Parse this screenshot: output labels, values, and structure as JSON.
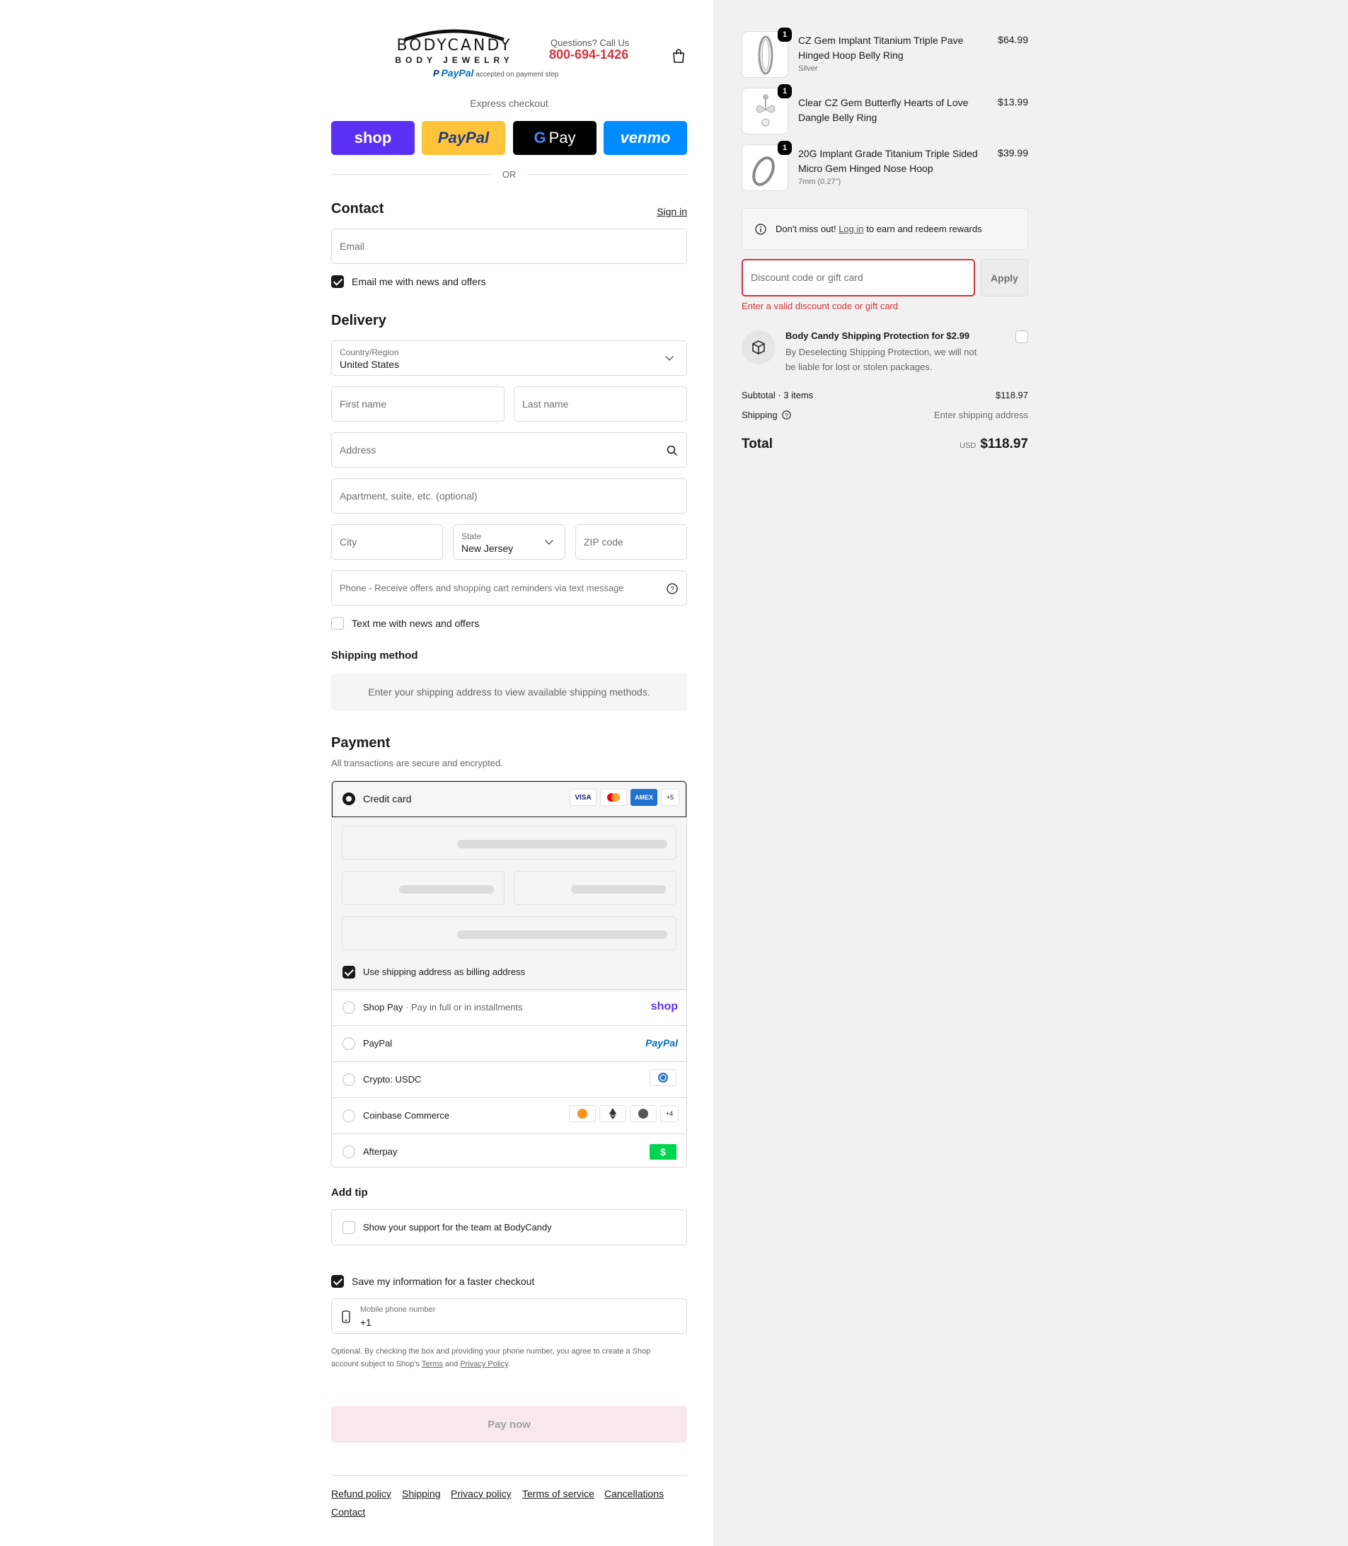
{
  "header": {
    "brand_name": "BODYCANDY",
    "brand_sub": "BODY JEWELRY",
    "questions_label": "Questions? Call Us",
    "phone": "800-694-1426",
    "paypal_label": "PayPal",
    "paypal_note": "accepted on payment step"
  },
  "express": {
    "title": "Express checkout",
    "shop": "shop",
    "paypal": "PayPal",
    "gpay": "Pay",
    "venmo": "venmo",
    "or": "OR"
  },
  "contact": {
    "title": "Contact",
    "sign_in": "Sign in",
    "email_placeholder": "Email",
    "newsletter_label": "Email me with news and offers"
  },
  "delivery": {
    "title": "Delivery",
    "country_label": "Country/Region",
    "country_value": "United States",
    "first_name": "First name",
    "last_name": "Last name",
    "address": "Address",
    "apartment": "Apartment, suite, etc. (optional)",
    "city": "City",
    "state_label": "State",
    "state_value": "New Jersey",
    "zip": "ZIP code",
    "phone": "Phone - Receive offers and shopping cart reminders via text message",
    "sms_label": "Text me with news and offers"
  },
  "shipping_method": {
    "title": "Shipping method",
    "notice": "Enter your shipping address to view available shipping methods."
  },
  "payment": {
    "title": "Payment",
    "subtitle": "All transactions are secure and encrypted.",
    "credit_card": "Credit card",
    "cards": [
      "VISA",
      "AMEX",
      "+5"
    ],
    "billing_label": "Use shipping address as billing address",
    "shop_pay": "Shop Pay",
    "shop_pay_note": "Pay in full or in installments",
    "shop_logo": "shop",
    "paypal": "PayPal",
    "paypal_logo": "PayPal",
    "crypto": "Crypto: USDC",
    "coinbase": "Coinbase Commerce",
    "coinbase_more": "+4",
    "afterpay": "Afterpay",
    "afterpay_logo": "$"
  },
  "tip": {
    "title": "Add tip",
    "label": "Show your support for the team at BodyCandy"
  },
  "save_info": {
    "label": "Save my information for a faster checkout",
    "mobile_label": "Mobile phone number",
    "mobile_value": "+1",
    "legal_1": "Optional. By checking the box and providing your phone number, you agree to create a Shop",
    "legal_2": "account subject to Shop's",
    "terms": "Terms",
    "and": "and",
    "privacy": "Privacy Policy",
    "period": "."
  },
  "pay_now": "Pay now",
  "footer": [
    "Refund policy",
    "Shipping",
    "Privacy policy",
    "Terms of service",
    "Cancellations",
    "Contact"
  ],
  "order": {
    "items": [
      {
        "name_1": "CZ Gem Implant Titanium Triple Pave",
        "name_2": "Hinged Hoop Belly Ring",
        "variant": "Silver",
        "price": "$64.99",
        "qty": "1"
      },
      {
        "name_1": "Clear CZ Gem Butterfly Hearts of Love",
        "name_2": "Dangle Belly Ring",
        "variant": "",
        "price": "$13.99",
        "qty": "1"
      },
      {
        "name_1": "20G Implant Grade Titanium Triple Sided",
        "name_2": "Micro Gem Hinged Nose Hoop",
        "variant": "7mm (0.27\")",
        "price": "$39.99",
        "qty": "1"
      }
    ],
    "rewards_pre": "Don't miss out!",
    "rewards_link": "Log in",
    "rewards_post": "to earn and redeem rewards",
    "discount_placeholder": "Discount code or gift card",
    "apply": "Apply",
    "discount_error": "Enter a valid discount code or gift card",
    "protection_title": "Body Candy Shipping Protection for $2.99",
    "protection_desc_1": "By Deselecting Shipping Protection, we will not",
    "protection_desc_2": "be liable for lost or stolen packages.",
    "subtotal_label": "Subtotal · 3 items",
    "subtotal_value": "$118.97",
    "shipping_label": "Shipping",
    "shipping_value": "Enter shipping address",
    "total_label": "Total",
    "currency": "USD",
    "total_value": "$118.97"
  },
  "colors": {
    "accent": "#d2333f",
    "shop_purple": "#5a31f4",
    "paypal_yellow": "#ffc439",
    "venmo_blue": "#008cff",
    "paynow_bg": "#f7e9ea"
  }
}
